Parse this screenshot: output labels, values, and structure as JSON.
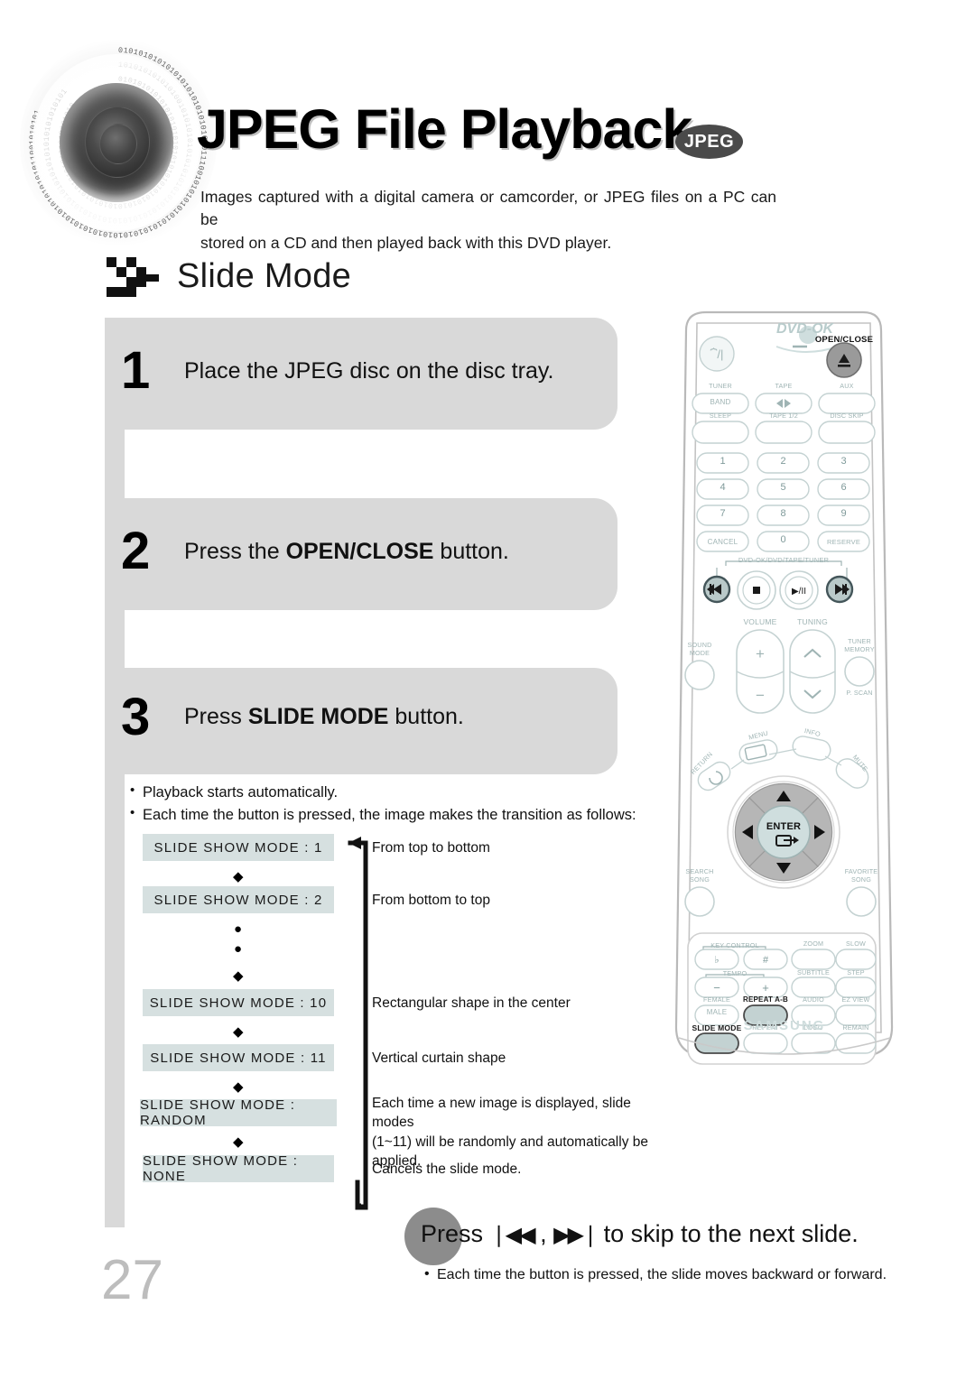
{
  "header": {
    "title": "JPEG File Playback",
    "badge": "JPEG",
    "intro_line1": "Images captured with a digital camera or camcorder, or JPEG files on a PC can be",
    "intro_line2": "stored on a CD and then played back with this DVD player."
  },
  "section": {
    "title": "Slide Mode"
  },
  "steps": [
    {
      "number": "1",
      "text_before": "Place the JPEG disc on the disc tray.",
      "text_bold": "",
      "text_after": ""
    },
    {
      "number": "2",
      "text_before": "Press the ",
      "text_bold": "OPEN/CLOSE",
      "text_after": " button."
    },
    {
      "number": "3",
      "text_before": "Press ",
      "text_bold": "SLIDE MODE",
      "text_after": " button."
    }
  ],
  "bullets": [
    "Playback starts automatically.",
    "Each time the button is pressed, the image makes the transition as follows:"
  ],
  "flow": {
    "items": [
      {
        "label": "SLIDE SHOW MODE : 1",
        "desc": "From top to bottom"
      },
      {
        "label": "SLIDE SHOW MODE : 2",
        "desc": "From bottom to top"
      },
      {
        "label": "SLIDE SHOW MODE : 10",
        "desc": "Rectangular shape in the center"
      },
      {
        "label": "SLIDE SHOW MODE : 11",
        "desc": "Vertical curtain shape"
      },
      {
        "label": "SLIDE SHOW MODE : RANDOM",
        "desc": "Each time a new image is displayed, slide modes"
      },
      {
        "label": "SLIDE SHOW MODE : NONE",
        "desc": "Cancels the slide mode."
      }
    ],
    "random_desc_line2": "(1~11) will be randomly and automatically be applied."
  },
  "skip": {
    "text_before": "Press ",
    "glyph_prev": "❘◀◀",
    "separator": " , ",
    "glyph_next": "▶▶❘",
    "text_after": " to skip to the next slide.",
    "note": "Each time the button is pressed, the slide moves backward or forward."
  },
  "page_number": "27",
  "remote": {
    "brand_top": "DVD-OK",
    "brand_bottom": "SAMSUNG",
    "open_close": "OPEN/CLOSE",
    "labels": {
      "tuner": "TUNER",
      "band": "BAND",
      "tape": "TAPE",
      "aux": "AUX",
      "sleep": "SLEEP",
      "tape12": "TAPE 1/2",
      "disc_skip": "DISC SKIP",
      "cancel": "CANCEL",
      "reserve": "RESERVE",
      "transport_group": "DVD-OK/DVD/TAPE/TUNER",
      "volume": "VOLUME",
      "tuning": "TUNING",
      "sound_mode_1": "SOUND",
      "sound_mode_2": "MODE",
      "tuner_memory_1": "TUNER",
      "tuner_memory_2": "MEMORY",
      "p_scan": "P. SCAN",
      "menu": "MENU",
      "info": "INFO",
      "return": "RETURN",
      "mute": "MUTE",
      "enter": "ENTER",
      "search_song_1": "SEARCH",
      "search_song_2": "SONG",
      "favorite_song_1": "FAVORITE",
      "favorite_song_2": "SONG",
      "key_control": "KEY CONTROL",
      "zoom": "ZOOM",
      "slow": "SLOW",
      "tempo": "TEMPO",
      "subtitle": "SUBTITLE",
      "step": "STEP",
      "female": "FEMALE",
      "male": "MALE",
      "repeat_ab": "REPEAT A-B",
      "audio": "AUDIO",
      "ez_view": "EZ VIEW",
      "slide_mode": "SLIDE MODE",
      "repeat": "REPEAT",
      "logo": "LOGO",
      "remain": "REMAIN"
    },
    "keypad": [
      "1",
      "2",
      "3",
      "4",
      "5",
      "6",
      "7",
      "8",
      "9",
      "0"
    ]
  }
}
